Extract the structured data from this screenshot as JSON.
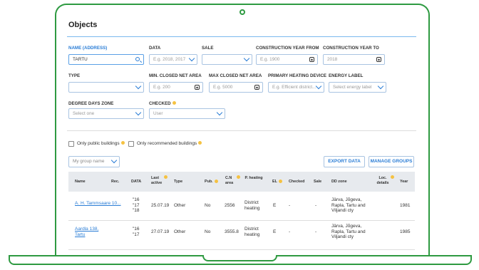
{
  "page": {
    "title": "Objects"
  },
  "filters": {
    "name": {
      "label": "NAME (ADDRESS)",
      "value": "TARTU"
    },
    "data": {
      "label": "DATA",
      "placeholder": "E.g. 2018, 2017"
    },
    "sale": {
      "label": "SALE",
      "value": ""
    },
    "cy_from": {
      "label": "CONSTRUCTION YEAR FROM",
      "placeholder": "E.g. 1900"
    },
    "cy_to": {
      "label": "CONSTRUCTION YEAR TO",
      "placeholder": "2018"
    },
    "type": {
      "label": "TYPE",
      "value": ""
    },
    "min_area": {
      "label": "MIN. CLOSED NET AREA",
      "placeholder": "E.g. 200"
    },
    "max_area": {
      "label": "MAX CLOSED NET AREA",
      "placeholder": "E.g. 5000"
    },
    "heating": {
      "label": "PRIMARY HEATING DEVICE",
      "placeholder": "E.g. Efficient district..."
    },
    "energy": {
      "label": "ENERGY LABEL",
      "placeholder": "Select energy label"
    },
    "ddz": {
      "label": "DEGREE DAYS ZONE",
      "placeholder": "Select one"
    },
    "checked": {
      "label": "CHECKED",
      "placeholder": "User"
    }
  },
  "options": {
    "public": "Only public buildings",
    "recommended": "Only recommended buildings"
  },
  "toolbar": {
    "group": "My group name",
    "export": "EXPORT DATA",
    "manage": "MANAGE GROUPS"
  },
  "table": {
    "headers": {
      "name": "Name",
      "rec": "Rec.",
      "data": "DATA",
      "last_active": "Last active",
      "type": "Type",
      "pub": "Pub.",
      "cn_area": "C.N area",
      "p_heating": "P. heating",
      "el": "EL",
      "checked": "Checked",
      "sale": "Sale",
      "dd_zone": "DD zone",
      "loc_details": "Loc. details",
      "year": "Year"
    },
    "rows": [
      {
        "name": "A. H. Tammsaare 10...",
        "rec": "",
        "data": "\"16\n\"17\n\"18",
        "last_active": "25.07.19",
        "type": "Other",
        "pub": "No",
        "cn_area": "2556",
        "p_heating": "District\nheating",
        "el": "E",
        "checked": "-",
        "sale": "-",
        "dd_zone": "Järva, Jõgeva,\nRapla, Tartu and\nViljandi cty",
        "loc_details": "",
        "year": "1981"
      },
      {
        "name": "Aardla 138,\nTartu",
        "rec": "",
        "data": "\"16\n\"17",
        "last_active": "27.07.19",
        "type": "Other",
        "pub": "No",
        "cn_area": "3555.8",
        "p_heating": "District\nheating",
        "el": "E",
        "checked": "-",
        "sale": "-",
        "dd_zone": "Järva, Jõgeva,\nRapla, Tartu and\nViljandi cty",
        "loc_details": "",
        "year": "1985"
      }
    ]
  },
  "colors": {
    "accent": "#2a7dd6",
    "frame": "#2e9a41",
    "badge": "#f5c242"
  }
}
